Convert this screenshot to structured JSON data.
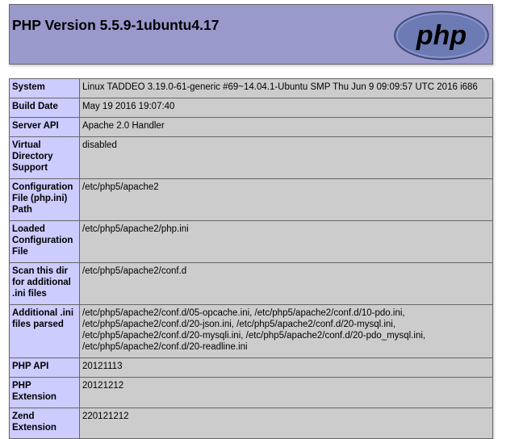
{
  "header": {
    "title": "PHP Version 5.5.9-1ubuntu4.17",
    "logo_text": "php"
  },
  "rows": [
    {
      "key": "System",
      "value": "Linux TADDEO 3.19.0-61-generic #69~14.04.1-Ubuntu SMP Thu Jun 9 09:09:57 UTC 2016 i686"
    },
    {
      "key": "Build Date",
      "value": "May 19 2016 19:07:40"
    },
    {
      "key": "Server API",
      "value": "Apache 2.0 Handler"
    },
    {
      "key": "Virtual Directory Support",
      "value": "disabled"
    },
    {
      "key": "Configuration File (php.ini) Path",
      "value": "/etc/php5/apache2"
    },
    {
      "key": "Loaded Configuration File",
      "value": "/etc/php5/apache2/php.ini"
    },
    {
      "key": "Scan this dir for additional .ini files",
      "value": "/etc/php5/apache2/conf.d"
    },
    {
      "key": "Additional .ini files parsed",
      "value": "/etc/php5/apache2/conf.d/05-opcache.ini, /etc/php5/apache2/conf.d/10-pdo.ini, /etc/php5/apache2/conf.d/20-json.ini, /etc/php5/apache2/conf.d/20-mysql.ini, /etc/php5/apache2/conf.d/20-mysqli.ini, /etc/php5/apache2/conf.d/20-pdo_mysql.ini, /etc/php5/apache2/conf.d/20-readline.ini"
    },
    {
      "key": "PHP API",
      "value": "20121113"
    },
    {
      "key": "PHP Extension",
      "value": "20121212"
    },
    {
      "key": "Zend Extension",
      "value": "220121212"
    }
  ],
  "colors": {
    "header_bg": "#9999cc",
    "key_bg": "#ccccff",
    "value_bg": "#cccccc",
    "logo_fill": "#6c7bb4"
  }
}
